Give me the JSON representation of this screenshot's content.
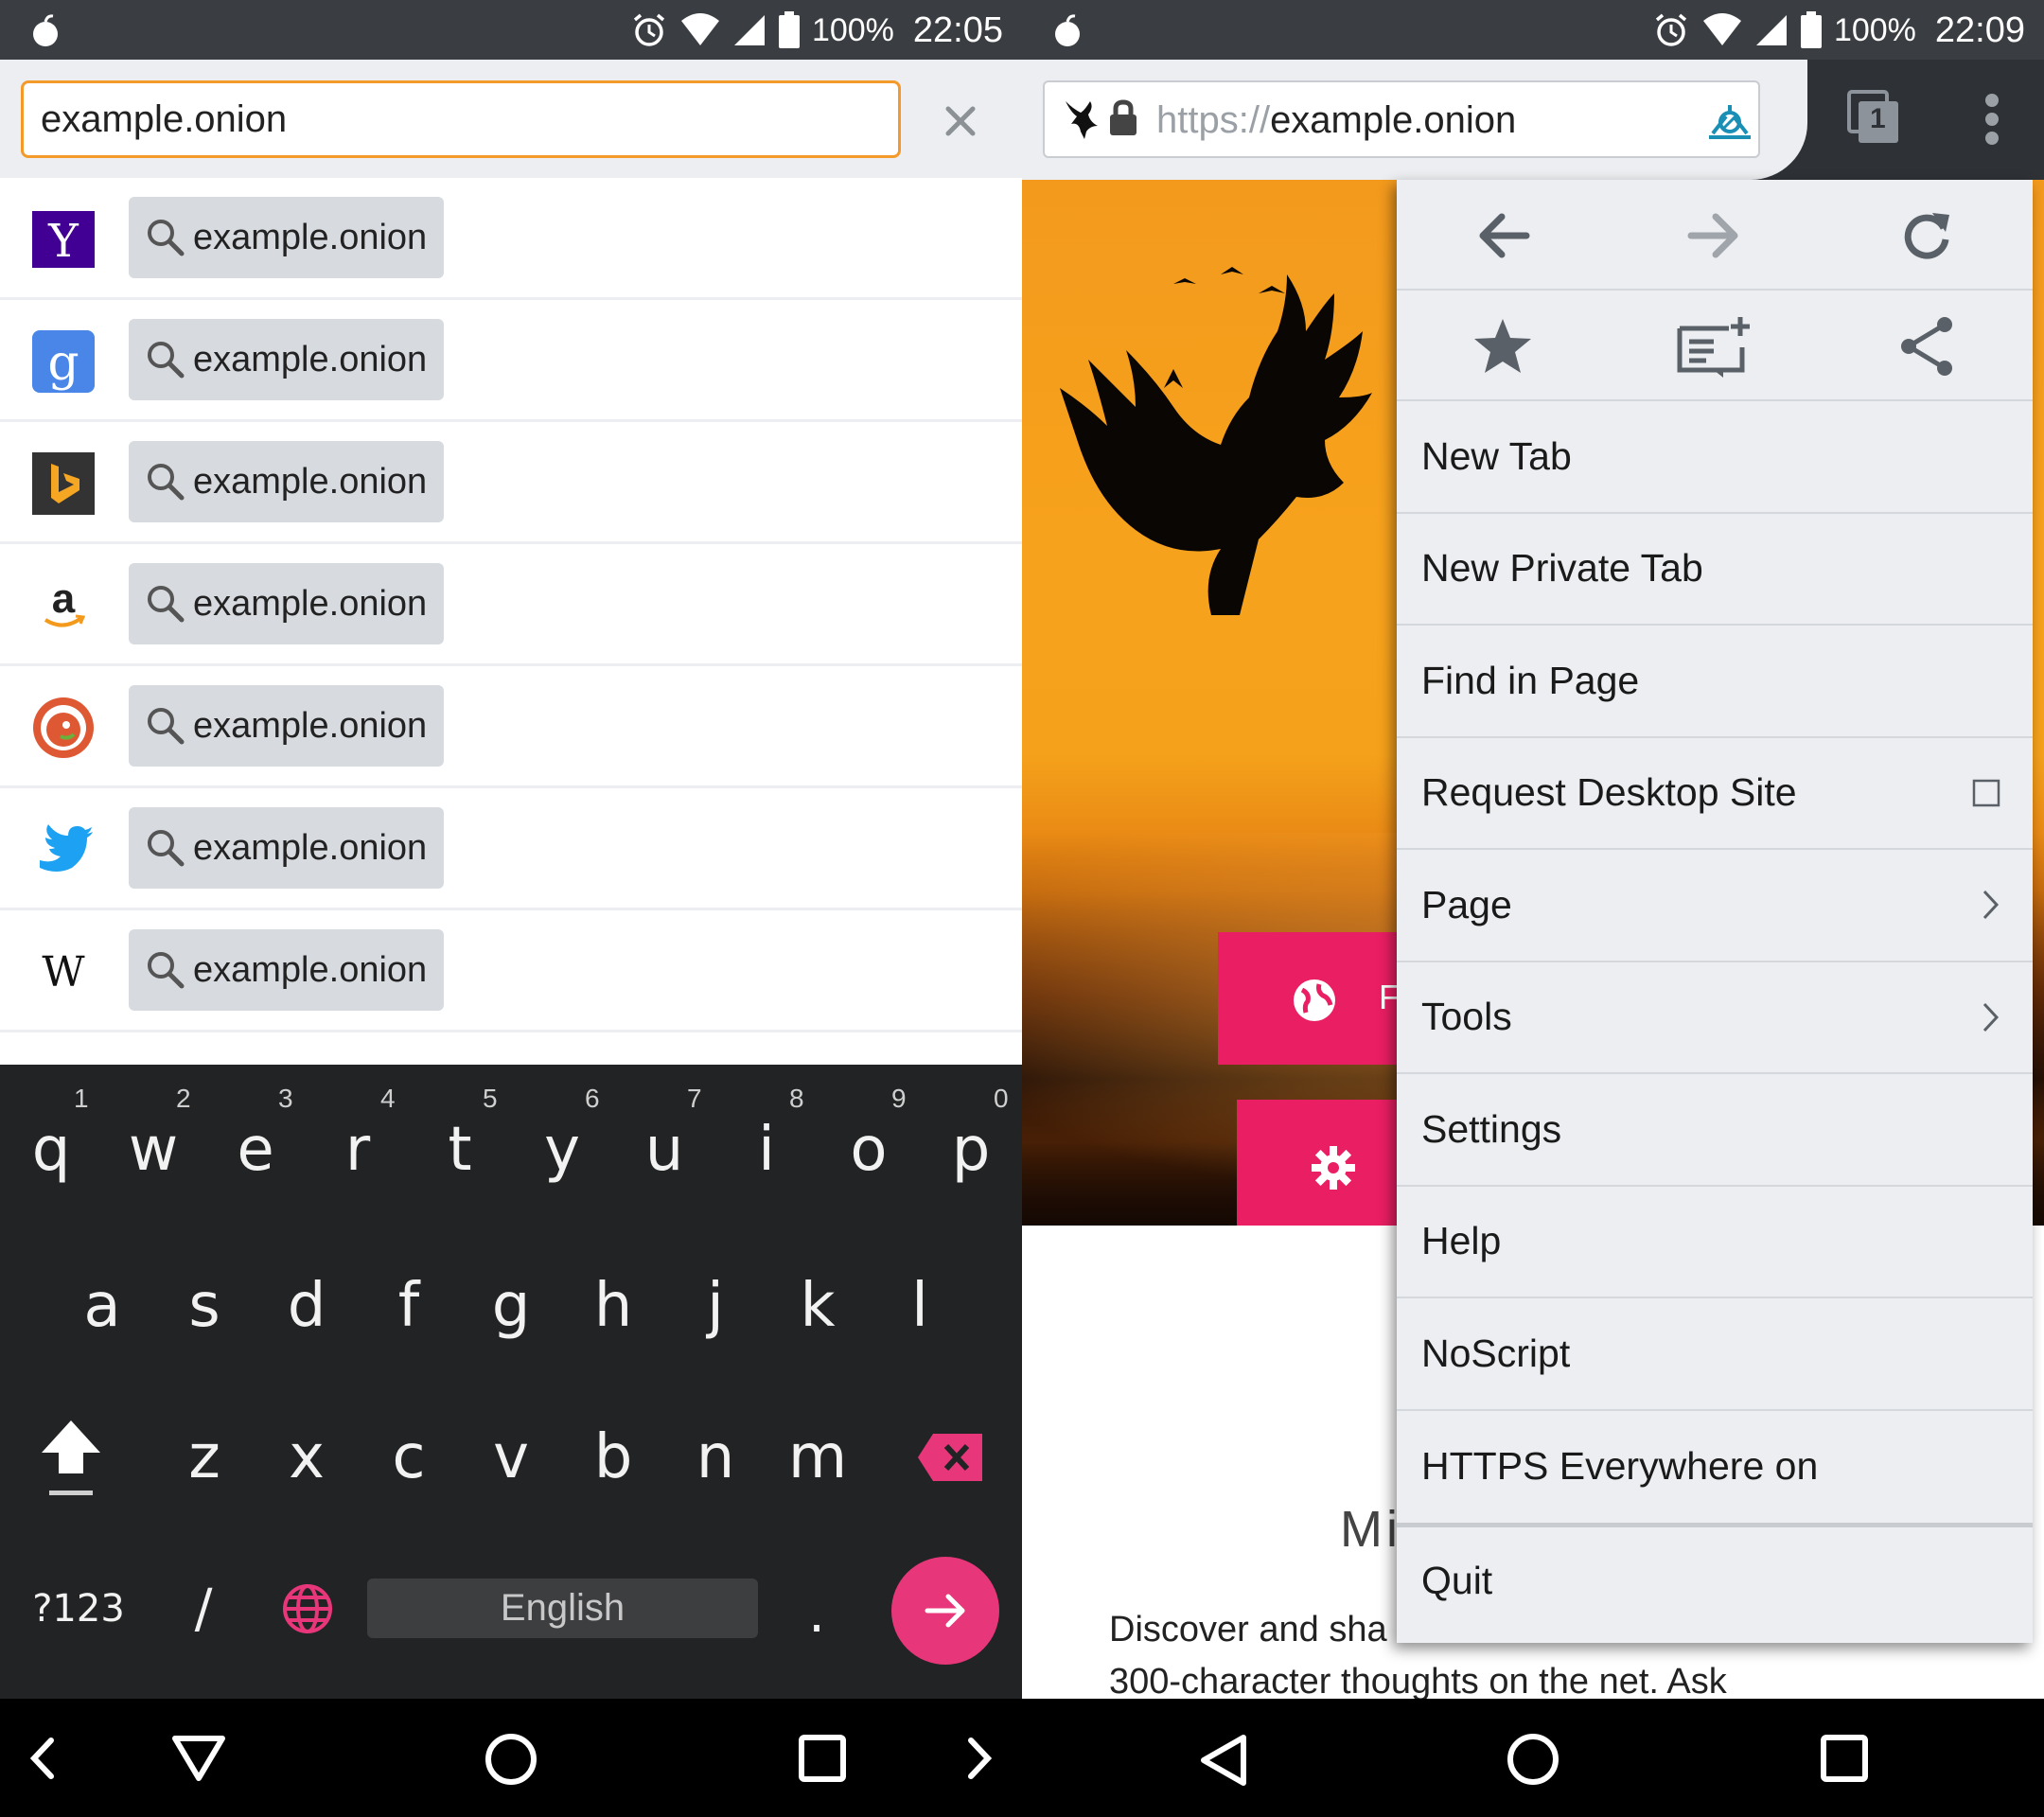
{
  "left": {
    "status": {
      "battery": "100%",
      "time": "22:05"
    },
    "url_input": {
      "value": "example.onion"
    },
    "suggestions": [
      {
        "engine": "Yahoo",
        "query": "example.onion"
      },
      {
        "engine": "Google",
        "query": "example.onion"
      },
      {
        "engine": "Bing",
        "query": "example.onion"
      },
      {
        "engine": "Amazon",
        "query": "example.onion"
      },
      {
        "engine": "DuckDuckGo",
        "query": "example.onion"
      },
      {
        "engine": "Twitter",
        "query": "example.onion"
      },
      {
        "engine": "Wikipedia",
        "query": "example.onion"
      }
    ],
    "keyboard": {
      "row1": [
        "q",
        "w",
        "e",
        "r",
        "t",
        "y",
        "u",
        "i",
        "o",
        "p"
      ],
      "row1_hints": [
        "1",
        "2",
        "3",
        "4",
        "5",
        "6",
        "7",
        "8",
        "9",
        "0"
      ],
      "row2": [
        "a",
        "s",
        "d",
        "f",
        "g",
        "h",
        "j",
        "k",
        "l"
      ],
      "row3": [
        "z",
        "x",
        "c",
        "v",
        "b",
        "n",
        "m"
      ],
      "symbols_label": "?123",
      "slash": "/",
      "period": ".",
      "space_label": "English"
    }
  },
  "right": {
    "status": {
      "battery": "100%",
      "time": "22:09"
    },
    "url": {
      "scheme": "https://",
      "host": "example.onion"
    },
    "tab_count": "1",
    "menu": {
      "items": [
        {
          "label": "New Tab"
        },
        {
          "label": "New Private Tab"
        },
        {
          "label": "Find in Page"
        },
        {
          "label": "Request Desktop Site"
        },
        {
          "label": "Page"
        },
        {
          "label": "Tools"
        },
        {
          "label": "Settings"
        },
        {
          "label": "Help"
        },
        {
          "label": "NoScript"
        },
        {
          "label": "HTTPS Everywhere on"
        }
      ],
      "quit_label": "Quit"
    },
    "page": {
      "button1_letter": "F",
      "heading_fragment": "Mi",
      "body_line1": "Discover and sha",
      "body_line2": "300-character thoughts on the net. Ask"
    }
  },
  "colors": {
    "accent_orange": "#f39a2b",
    "pink": "#e91e63",
    "keyboard_bg": "#222324",
    "chrome_bg": "#eceef1"
  }
}
